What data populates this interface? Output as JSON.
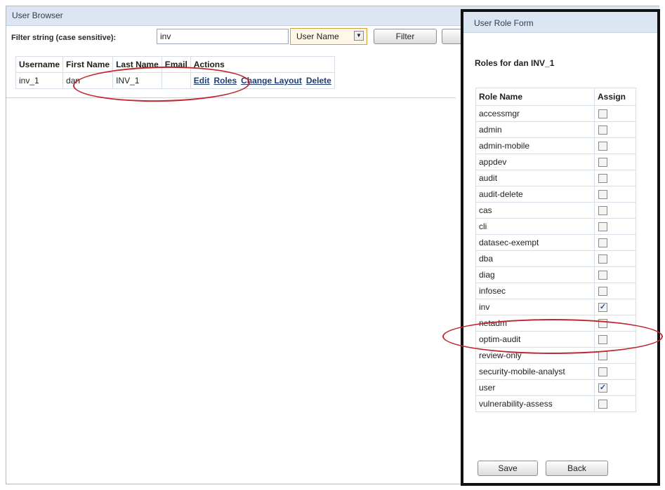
{
  "user_browser": {
    "title": "User Browser",
    "filter_label": "Filter string (case sensitive):",
    "filter_value": "inv",
    "filter_field": "User Name",
    "filter_button": "Filter",
    "columns": [
      "Username",
      "First Name",
      "Last Name",
      "Email",
      "Actions"
    ],
    "row": {
      "username": "inv_1",
      "first_name": "dan",
      "last_name": "INV_1",
      "email": "",
      "actions": [
        "Edit",
        "Roles",
        "Change Layout",
        "Delete"
      ]
    }
  },
  "role_form": {
    "title": "User Role Form",
    "heading": "Roles for dan INV_1",
    "col_role": "Role Name",
    "col_assign": "Assign",
    "roles": [
      {
        "name": "accessmgr",
        "assigned": false
      },
      {
        "name": "admin",
        "assigned": false
      },
      {
        "name": "admin-mobile",
        "assigned": false
      },
      {
        "name": "appdev",
        "assigned": false
      },
      {
        "name": "audit",
        "assigned": false
      },
      {
        "name": "audit-delete",
        "assigned": false
      },
      {
        "name": "cas",
        "assigned": false
      },
      {
        "name": "cli",
        "assigned": false
      },
      {
        "name": "datasec-exempt",
        "assigned": false
      },
      {
        "name": "dba",
        "assigned": false
      },
      {
        "name": "diag",
        "assigned": false
      },
      {
        "name": "infosec",
        "assigned": false
      },
      {
        "name": "inv",
        "assigned": true
      },
      {
        "name": "netadm",
        "assigned": false
      },
      {
        "name": "optim-audit",
        "assigned": false
      },
      {
        "name": "review-only",
        "assigned": false
      },
      {
        "name": "security-mobile-analyst",
        "assigned": false
      },
      {
        "name": "user",
        "assigned": true
      },
      {
        "name": "vulnerability-assess",
        "assigned": false
      }
    ],
    "save_label": "Save",
    "back_label": "Back"
  },
  "colors": {
    "header_bg": "#dbe6f2",
    "highlight_ellipse": "#c0272d",
    "link": "#1d3d7a"
  }
}
